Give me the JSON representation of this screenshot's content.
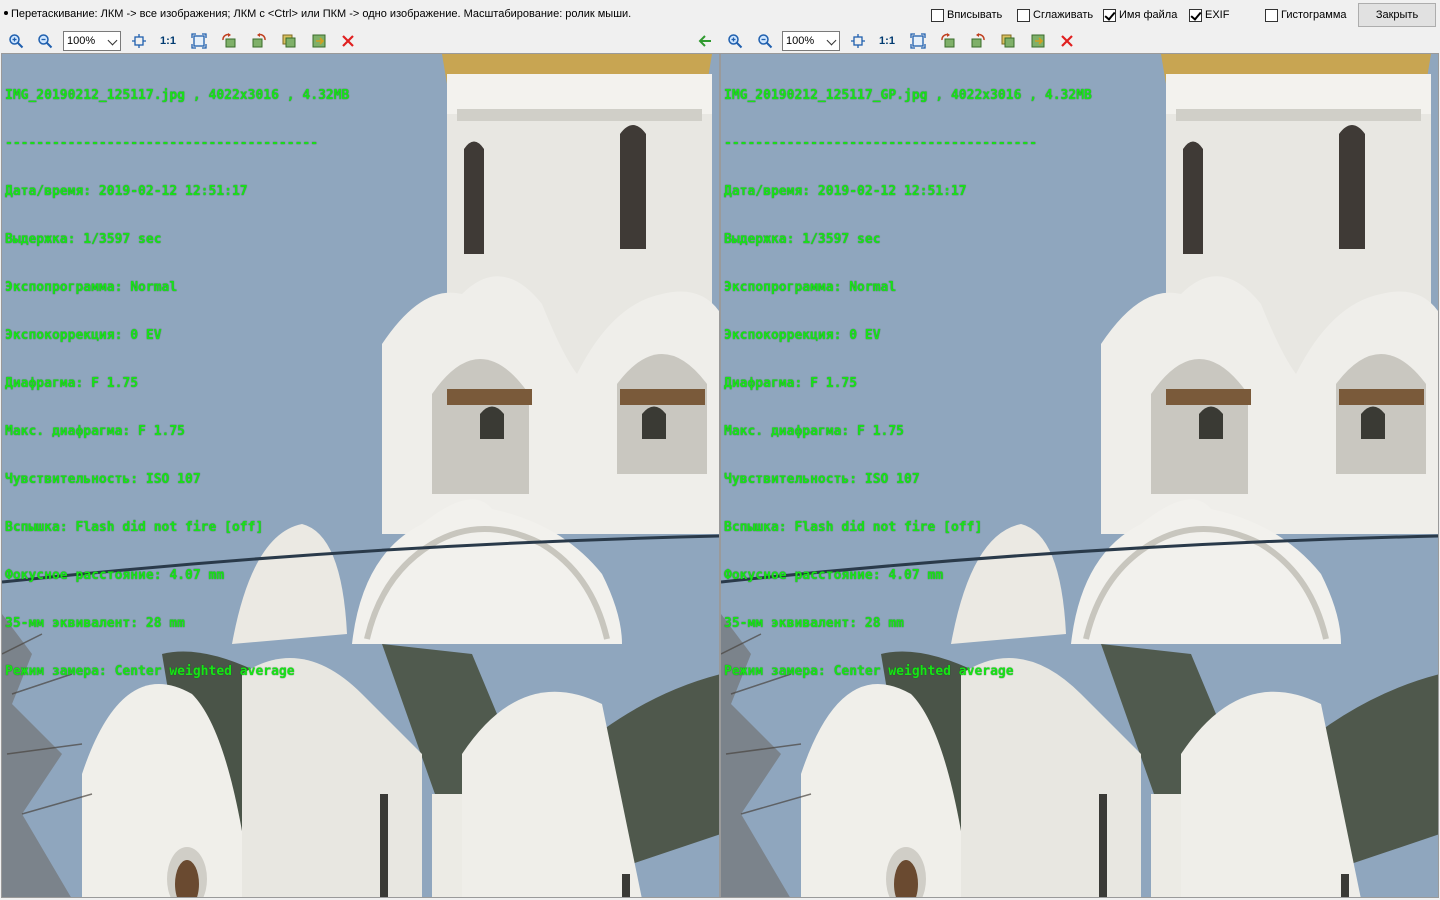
{
  "hint": "Перетаскивание: ЛКМ -> все изображения; ЛКМ с <Ctrl> или ПКМ -> одно изображение. Масштабирование: ролик мыши.",
  "options": [
    {
      "label": "Вписывать",
      "checked": false
    },
    {
      "label": "Сглаживать",
      "checked": false
    },
    {
      "label": "Имя файла",
      "checked": true
    },
    {
      "label": "EXIF",
      "checked": true
    },
    {
      "label": "Гистограмма",
      "checked": false
    }
  ],
  "close_label": "Закрыть",
  "toolbar": {
    "zoom_value": "100%",
    "one_to_one_label": "1:1",
    "icons": [
      "zoom-in-icon",
      "zoom-out-icon",
      "fit-icon",
      "fullscreen-icon",
      "rotate-left-icon",
      "rotate-right-icon",
      "copy-icon",
      "save-icon",
      "close-icon",
      "arrow-left-icon"
    ]
  },
  "panes": [
    {
      "filename_line": "IMG_20190212_125117.jpg , 4022x3016 , 4.32MB",
      "separator": "----------------------------------------",
      "exif": [
        "Дата/время: 2019-02-12 12:51:17",
        "Выдержка: 1/3597 sec",
        "Экспопрограмма: Normal",
        "Экспокоррекция: 0 EV",
        "Диафрагма: F 1.75",
        "Макс. диафрагма: F 1.75",
        "Чувствительность: ISO 107",
        "Вспышка: Flash did not fire [off]",
        "Фокусное расстояние: 4.07 mm",
        "35-мм эквивалент: 28 mm",
        "Режим замера: Center weighted average"
      ]
    },
    {
      "filename_line": "IMG_20190212_125117_GP.jpg , 4022x3016 , 4.32MB",
      "separator": "----------------------------------------",
      "exif": [
        "Дата/время: 2019-02-12 12:51:17",
        "Выдержка: 1/3597 sec",
        "Экспопрограмма: Normal",
        "Экспокоррекция: 0 EV",
        "Диафрагма: F 1.75",
        "Макс. диафрагма: F 1.75",
        "Чувствительность: ISO 107",
        "Вспышка: Flash did not fire [off]",
        "Фокусное расстояние: 4.07 mm",
        "35-мм эквивалент: 28 mm",
        "Режим замера: Center weighted average"
      ]
    }
  ],
  "colors": {
    "overlay_text": "#17e317",
    "sky": "#8fa6be",
    "wall": "#ecebe6",
    "roof": "#4a5448",
    "close_icon": "#e02020"
  }
}
